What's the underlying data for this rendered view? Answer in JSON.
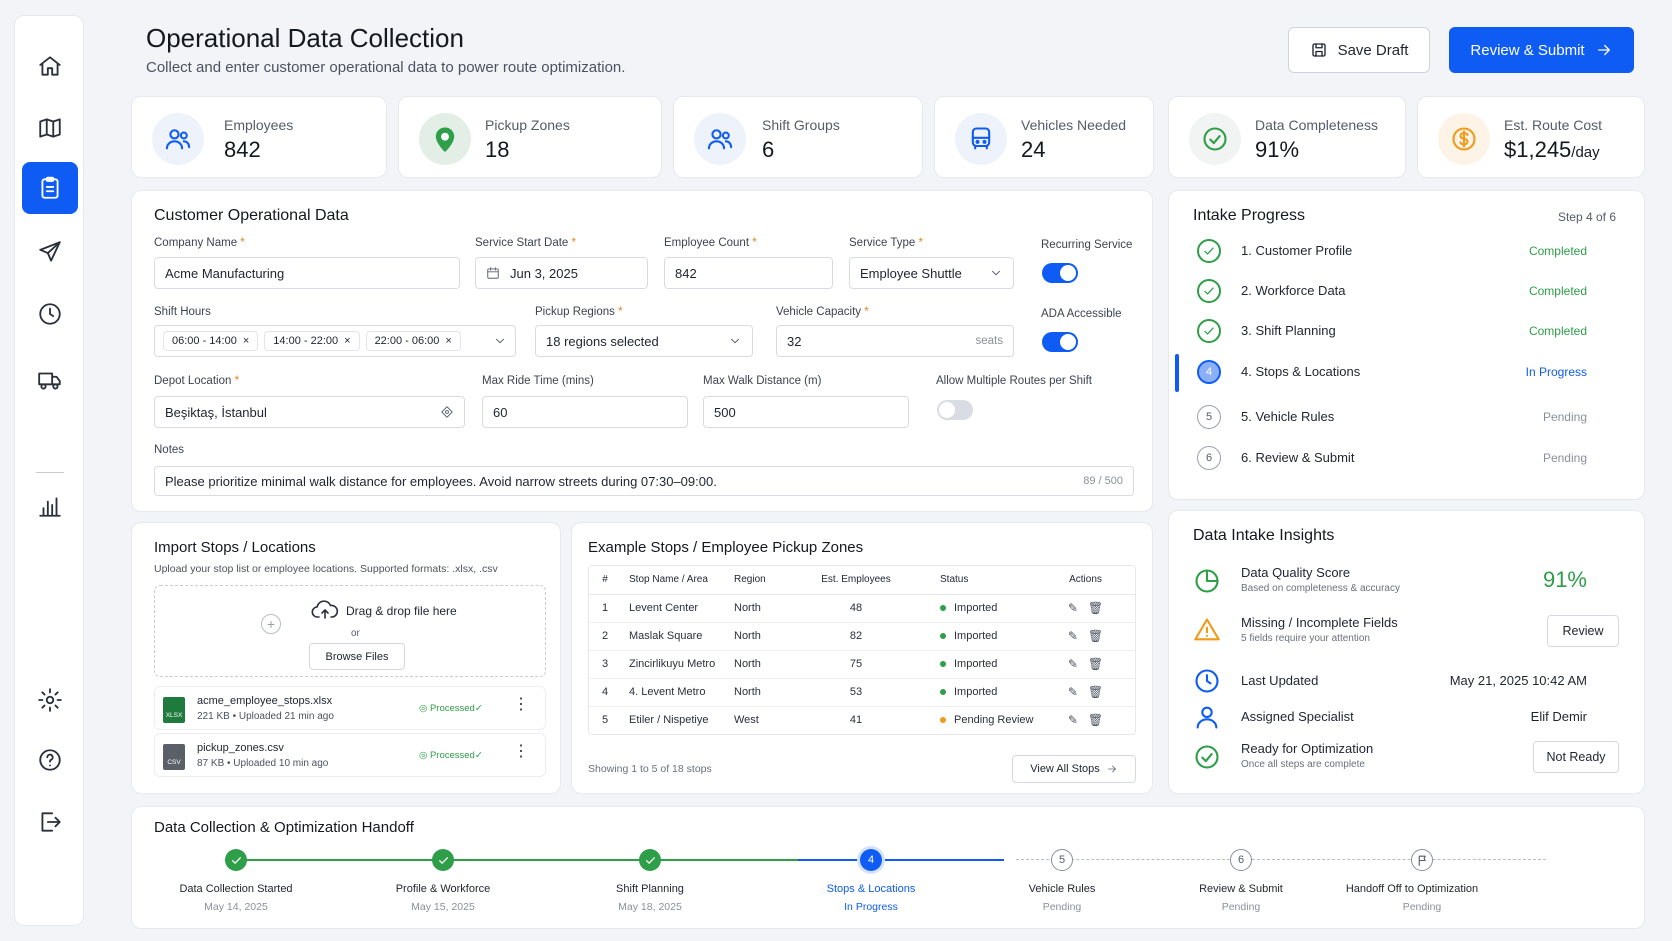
{
  "nav": {
    "items": [
      "home-icon",
      "map-icon",
      "clipboard-icon",
      "send-icon",
      "clock-icon",
      "truck-icon",
      "bar-chart-icon",
      "gear-icon",
      "help-icon",
      "logout-icon"
    ],
    "active": "clipboard-icon"
  },
  "header": {
    "title": "Operational Data Collection",
    "subtitle": "Collect and enter customer operational data to power route optimization.",
    "save_label": "Save Draft",
    "submit_label": "Review & Submit"
  },
  "stats": [
    {
      "label": "Employees",
      "value": "842",
      "icon": "users-icon"
    },
    {
      "label": "Pickup Zones",
      "value": "18",
      "icon": "map-pin-icon"
    },
    {
      "label": "Shift Groups",
      "value": "6",
      "icon": "users-icon"
    },
    {
      "label": "Vehicles Needed",
      "value": "24",
      "icon": "bus-icon"
    },
    {
      "label": "Data Completeness",
      "value": "91%",
      "icon": "check-circle-icon"
    },
    {
      "label": "Est. Route Cost",
      "value": "$1,245",
      "unit": "/day",
      "icon": "dollar-icon"
    }
  ],
  "form": {
    "title": "Customer Operational Data",
    "company_label": "Company Name",
    "company_value": "Acme Manufacturing",
    "start_label": "Service Start Date",
    "start_value": "Jun 3, 2025",
    "count_label": "Employee Count",
    "count_value": "842",
    "type_label": "Service Type",
    "type_value": "Employee Shuttle",
    "recurring_label": "Recurring Service",
    "recurring_on": true,
    "shift_label": "Shift Hours",
    "shifts": [
      "06:00 - 14:00",
      "14:00 - 22:00",
      "22:00 - 06:00"
    ],
    "regions_label": "Pickup Regions",
    "regions_value": "18 regions selected",
    "capacity_label": "Vehicle Capacity",
    "capacity_value": "32",
    "capacity_unit": "seats",
    "ada_label": "ADA Accessible",
    "ada_on": true,
    "depot_label": "Depot Location",
    "depot_value": "Beşiktaş, İstanbul",
    "ride_label": "Max Ride Time (mins)",
    "ride_value": "60",
    "walk_label": "Max Walk Distance (m)",
    "walk_value": "500",
    "multi_label": "Allow Multiple Routes per Shift",
    "multi_on": false,
    "notes_label": "Notes",
    "notes_value": "Please prioritize minimal walk distance for employees. Avoid narrow streets during 07:30–09:00.",
    "notes_count": "89 / 500",
    "required_mark": "*"
  },
  "progress": {
    "title": "Intake Progress",
    "step_text": "Step 4 of 6",
    "steps": [
      {
        "label": "1. Customer Profile",
        "status": "Completed",
        "state": "done"
      },
      {
        "label": "2. Workforce Data",
        "status": "Completed",
        "state": "done"
      },
      {
        "label": "3. Shift Planning",
        "status": "Completed",
        "state": "done"
      },
      {
        "label": "4. Stops & Locations",
        "status": "In Progress",
        "state": "current",
        "num": "4"
      },
      {
        "label": "5. Vehicle Rules",
        "status": "Pending",
        "state": "pending",
        "num": "5"
      },
      {
        "label": "6. Review & Submit",
        "status": "Pending",
        "state": "pending",
        "num": "6"
      }
    ],
    "colors": {
      "done": "#2e9e48",
      "current": "#0e5cf4",
      "pending": "#8a909a"
    }
  },
  "import": {
    "title": "Import Stops / Locations",
    "subtitle": "Upload your stop list or employee locations. Supported formats: .xlsx, .csv",
    "drop_text": "Drag & drop file here",
    "or_text": "or",
    "browse_label": "Browse Files",
    "files": [
      {
        "name": "acme_employee_stops.xlsx",
        "meta": "221 KB • Uploaded 21 min ago",
        "status": "Processed✓",
        "badge": "XLSX"
      },
      {
        "name": "pickup_zones.csv",
        "meta": "87 KB • Uploaded 10 min ago",
        "status": "Processed✓",
        "badge": "CSV"
      }
    ]
  },
  "stops": {
    "title": "Example Stops / Employee Pickup Zones",
    "columns": [
      "#",
      "Stop Name / Area",
      "Region",
      "Est. Employees",
      "Status",
      "Actions"
    ],
    "rows": [
      {
        "n": "1",
        "name": "Levent Center",
        "region": "North",
        "emp": "48",
        "status": "Imported"
      },
      {
        "n": "2",
        "name": "Maslak Square",
        "region": "North",
        "emp": "82",
        "status": "Imported"
      },
      {
        "n": "3",
        "name": "Zincirlikuyu Metro",
        "region": "North",
        "emp": "75",
        "status": "Imported"
      },
      {
        "n": "4",
        "name": "4. Levent Metro",
        "region": "North",
        "emp": "53",
        "status": "Imported"
      },
      {
        "n": "5",
        "name": "Etiler / Nispetiye",
        "region": "West",
        "emp": "41",
        "status": "Pending Review"
      }
    ],
    "footer": "Showing 1 to 5 of 18 stops",
    "view_all": "View All Stops"
  },
  "insights": {
    "title": "Data Intake Insights",
    "quality_title": "Data Quality Score",
    "quality_sub": "Based on completeness & accuracy",
    "quality_value": "91%",
    "missing_title": "Missing / Incomplete Fields",
    "missing_sub": "5 fields require your attention",
    "missing_btn": "Review",
    "updated_title": "Last Updated",
    "updated_value": "May 21, 2025 10:42 AM",
    "specialist_title": "Assigned Specialist",
    "specialist_value": "Elif Demir",
    "ready_title": "Ready for Optimization",
    "ready_sub": "Once all steps are complete",
    "ready_btn": "Not Ready"
  },
  "handoff": {
    "title": "Data Collection & Optimization Handoff",
    "stages": [
      {
        "label": "Data Collection Started",
        "sub": "May 14, 2025",
        "state": "done"
      },
      {
        "label": "Profile & Workforce",
        "sub": "May 15, 2025",
        "state": "done"
      },
      {
        "label": "Shift Planning",
        "sub": "May 18, 2025",
        "state": "done"
      },
      {
        "label": "Stops & Locations",
        "sub": "In Progress",
        "state": "current",
        "num": "4"
      },
      {
        "label": "Vehicle Rules",
        "sub": "Pending",
        "state": "pending",
        "num": "5"
      },
      {
        "label": "Review & Submit",
        "sub": "Pending",
        "state": "pending",
        "num": "6"
      },
      {
        "label": "Handoff Off to Optimization",
        "sub": "Pending",
        "state": "pending",
        "num": ""
      }
    ]
  }
}
